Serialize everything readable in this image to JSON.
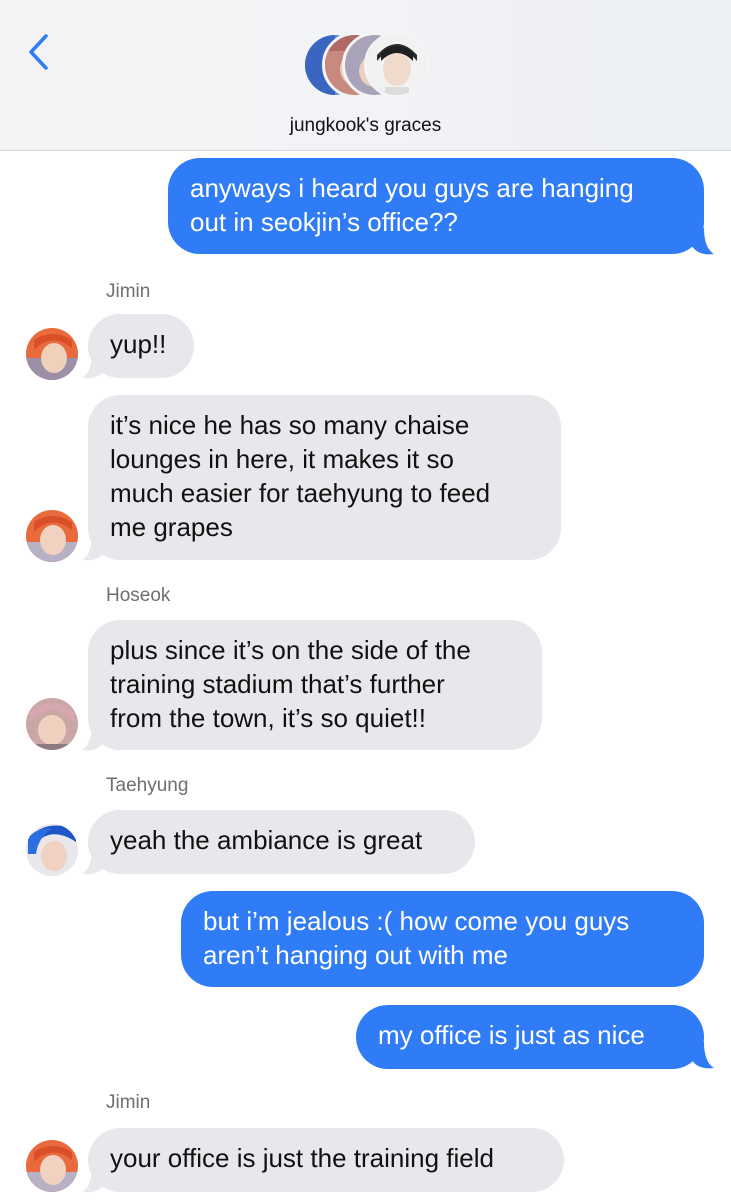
{
  "header": {
    "back_icon": "chevron-left-icon",
    "group_name": "jungkook's graces",
    "accent_color": "#2f7cf6"
  },
  "messages": [
    {
      "type": "sent",
      "lines": [
        "anyways i heard you guys are hanging",
        "out in seokjin’s office??"
      ]
    },
    {
      "type": "sender",
      "name": "Jimin"
    },
    {
      "type": "received",
      "lines": [
        "yup!!"
      ]
    },
    {
      "type": "received",
      "lines": [
        "it’s nice he has so many chaise",
        "lounges in here, it makes it so",
        "much easier for taehyung to feed",
        "me grapes"
      ]
    },
    {
      "type": "sender",
      "name": "Hoseok"
    },
    {
      "type": "received",
      "lines": [
        "plus since it’s on the side of the",
        "training stadium that’s further",
        "from the town, it’s so quiet!!"
      ]
    },
    {
      "type": "sender",
      "name": "Taehyung"
    },
    {
      "type": "received",
      "lines": [
        "yeah the ambiance is great"
      ]
    },
    {
      "type": "sent",
      "lines": [
        "but i’m jealous :( how come you guys",
        "aren’t hanging out with me"
      ]
    },
    {
      "type": "sent",
      "lines": [
        "my office is just as nice"
      ]
    },
    {
      "type": "sender",
      "name": "Jimin"
    },
    {
      "type": "received",
      "lines": [
        "your office is just the training field"
      ]
    }
  ],
  "colors": {
    "sent_bubble": "#2f7cf6",
    "received_bubble": "#e8e8ec",
    "sender_name": "#6e6e73"
  }
}
